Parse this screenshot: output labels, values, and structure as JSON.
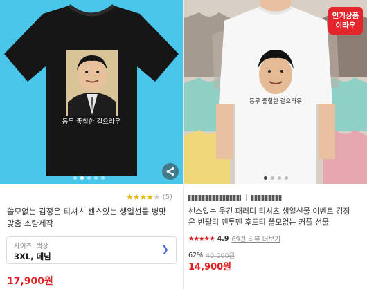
{
  "left": {
    "shirt_text": "동무 좋칠한 걸으라우",
    "rating_stars": 4,
    "review_count": "(5)",
    "title_line1": "쓸모없는 김정은 티셔츠 센스있는 생일선물 병맛",
    "title_line2": "맞춤 소량제작",
    "option_label": "사이즈, 색상",
    "option_value": "3XL, 데님",
    "price": "17,900원",
    "slide_dots": 5,
    "active_dot": 2
  },
  "right": {
    "badge_line1": "인기상품",
    "badge_line2": "이라우",
    "shirt_text": "동무 좋칠한 걸으라우",
    "title_line1": "센스있는 웃긴 패러디 티셔츠 생일선물 이벤트 김정",
    "title_line2": "은 반팔티 맨투맨 후드티 쓸모없는 커플 선물",
    "rating": "4.9",
    "review_link": "69건 리뷰 더보기",
    "discount": "62%",
    "original_price": "40,000원",
    "price": "14,900원",
    "slide_dots": 4,
    "active_dot": 1
  },
  "colors": {
    "left_bg": "#49c6ea",
    "price_red": "#e02020",
    "badge_red": "#e4262c",
    "star_gold": "#e6b800"
  },
  "icons": [
    "share-icon",
    "chevron-right-icon",
    "star-icon"
  ]
}
